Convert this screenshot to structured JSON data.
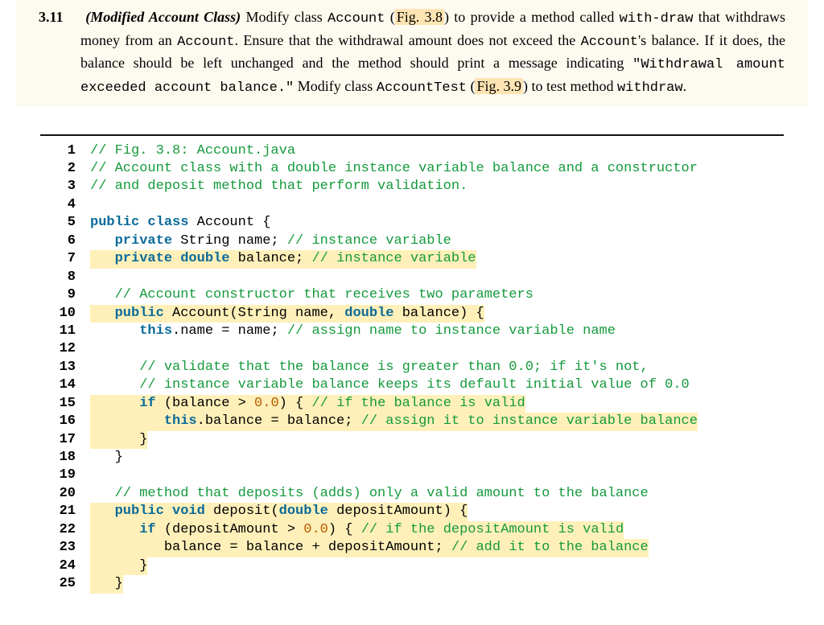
{
  "problem": {
    "number": "3.11",
    "title": "(Modified Account Class)",
    "t1": " Modify class ",
    "cls": "Account",
    "t2": " (",
    "fig1": "Fig. 3.8",
    "t3": ") to provide a method called ",
    "m1": "with-",
    "t3b": "draw",
    "t4": " that withdraws money from an ",
    "cls2": "Account",
    "t5": ". Ensure that the withdrawal amount does not exceed the ",
    "cls3": "Account",
    "t6": "'s balance. If it does, the balance should be left unchanged and the method should print a message indicating ",
    "msg": "\"Withdrawal amount exceeded account balance.\"",
    "t7": " Modify class ",
    "cls4": "AccountTest",
    "t8": " (",
    "fig2": "Fig. 3.9",
    "t9": ") to test method ",
    "m2": "withdraw",
    "t10": "."
  },
  "code": {
    "l1": {
      "n": "1",
      "c": "// Fig. 3.8: Account.java"
    },
    "l2": {
      "n": "2",
      "c": "// Account class with a double instance variable balance and a constructor"
    },
    "l3": {
      "n": "3",
      "c": "// and deposit method that perform validation."
    },
    "l4": {
      "n": "4"
    },
    "l5": {
      "n": "5",
      "k1": "public class ",
      "id": "Account ",
      "b": "{"
    },
    "l6": {
      "n": "6",
      "k1": "   private ",
      "id": "String name; ",
      "c": "// instance variable"
    },
    "l7": {
      "n": "7",
      "k1": "   private double ",
      "id": "balance; ",
      "c": "// instance variable"
    },
    "l8": {
      "n": "8"
    },
    "l9": {
      "n": "9",
      "c": "   // Account constructor that receives two parameters"
    },
    "l10": {
      "n": "10",
      "k1": "   public ",
      "id1": "Account(String name, ",
      "k2": "double ",
      "id2": "balance) {"
    },
    "l11": {
      "n": "11",
      "k1": "      this",
      "id": ".name = name; ",
      "c": "// assign name to instance variable name"
    },
    "l12": {
      "n": "12"
    },
    "l13": {
      "n": "13",
      "c": "      // validate that the balance is greater than 0.0; if it's not,"
    },
    "l14": {
      "n": "14",
      "c": "      // instance variable balance keeps its default initial value of 0.0"
    },
    "l15": {
      "n": "15",
      "k1": "      if ",
      "id1": "(balance > ",
      "lit": "0.0",
      "id2": ") { ",
      "c": "// if the balance is valid"
    },
    "l16": {
      "n": "16",
      "k1": "         this",
      "id": ".balance = balance; ",
      "c": "// assign it to instance variable balance"
    },
    "l17": {
      "n": "17",
      "id": "      }"
    },
    "l18": {
      "n": "18",
      "id": "   }"
    },
    "l19": {
      "n": "19"
    },
    "l20": {
      "n": "20",
      "c": "   // method that deposits (adds) only a valid amount to the balance"
    },
    "l21": {
      "n": "21",
      "k1": "   public void ",
      "id1": "deposit(",
      "k2": "double ",
      "id2": "depositAmount) {"
    },
    "l22": {
      "n": "22",
      "k1": "      if ",
      "id1": "(depositAmount > ",
      "lit": "0.0",
      "id2": ") { ",
      "c": "// if the depositAmount is valid"
    },
    "l23": {
      "n": "23",
      "id": "         balance = balance + depositAmount; ",
      "c": "// add it to the balance"
    },
    "l24": {
      "n": "24",
      "id": "      }"
    },
    "l25": {
      "n": "25",
      "id": "   }"
    }
  }
}
